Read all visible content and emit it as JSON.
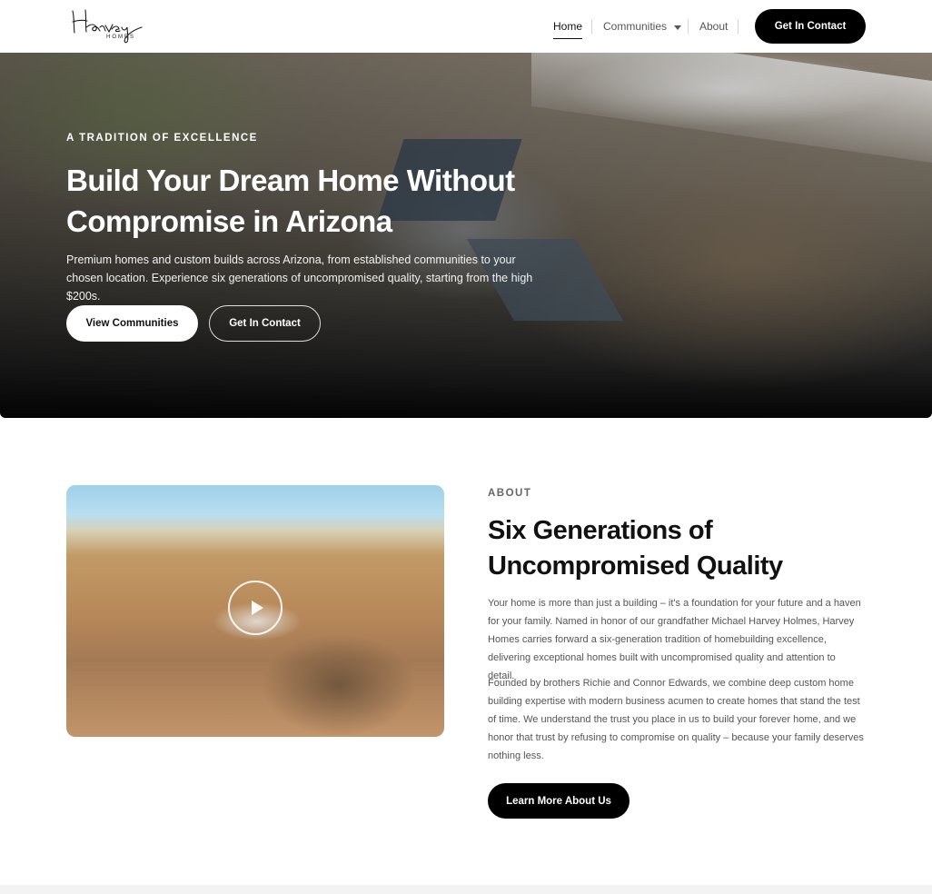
{
  "brand": {
    "logo_script": "Harvey",
    "logo_sub": "HOMES"
  },
  "nav": {
    "items": [
      {
        "label": "Home",
        "active": true
      },
      {
        "label": "Communities",
        "has_dropdown": true
      },
      {
        "label": "About"
      }
    ],
    "cta_label": "Get In Contact"
  },
  "hero": {
    "eyebrow": "A TRADITION OF EXCELLENCE",
    "title": "Build Your Dream Home Without Compromise in Arizona",
    "description": "Premium homes and custom builds across Arizona, from established communities to your chosen location. Experience six generations of uncompromised quality, starting from the high $200s.",
    "primary_button": "View Communities",
    "secondary_button": "Get In Contact"
  },
  "about": {
    "eyebrow": "ABOUT",
    "title": "Six Generations of Uncompromised Quality",
    "paragraph_1": "Your home is more than just a building – it's a foundation for your future and a haven for your family. Named in honor of our grandfather Michael Harvey Holmes, Harvey Homes carries forward a six-generation tradition of homebuilding excellence, delivering exceptional homes built with uncompromised quality and attention to detail.",
    "paragraph_2": "Founded by brothers Richie and Connor Edwards, we combine deep custom home building expertise with modern business acumen to create homes that stand the test of time. We understand the trust you place in us to build your forever home, and we honor that trust by refusing to compromise on quality – because your family deserves nothing less.",
    "button": "Learn More About Us",
    "video_icon": "play-icon"
  },
  "colors": {
    "primary": "#000000",
    "background": "#ffffff",
    "muted_text": "#555555"
  }
}
